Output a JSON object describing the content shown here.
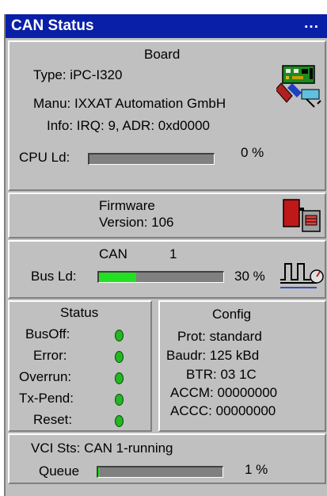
{
  "title": "CAN Status",
  "title_dots": "...",
  "board": {
    "heading": "Board",
    "type_line": "Type: iPC-I320",
    "manu_line": "Manu: IXXAT Automation GmbH",
    "info_line": "Info: IRQ: 9, ADR: 0xd0000",
    "cpu_label": "CPU Ld:",
    "cpu_value": "0 %",
    "cpu_fraction": 0,
    "icon": "pc-card-icon"
  },
  "firmware": {
    "heading": "Firmware",
    "version_line": "Version: 106",
    "icon": "firmware-chip-icon"
  },
  "can": {
    "heading": "CAN",
    "number": "1",
    "bus_label": "Bus Ld:",
    "bus_value": "30 %",
    "bus_fraction": 0.3,
    "icon": "bus-signal-icon"
  },
  "status": {
    "heading": "Status",
    "items": [
      "BusOff:",
      "Error:",
      "Overrun:",
      "Tx-Pend:",
      "Reset:"
    ]
  },
  "config": {
    "heading": "Config",
    "rows": [
      "Prot: standard",
      "Baudr: 125 kBd",
      "BTR: 03 1C",
      "ACCM: 00000000",
      "ACCC: 00000000"
    ]
  },
  "vci": {
    "status_line": "VCI Sts: CAN 1-running",
    "queue_label": "Queue",
    "queue_value": "1 %",
    "queue_fraction": 0.01
  },
  "colors": {
    "titlebar": "#0a1fa8",
    "led": "#22b822",
    "bus_fill": "#22e022",
    "panel": "#c0c0c0"
  }
}
